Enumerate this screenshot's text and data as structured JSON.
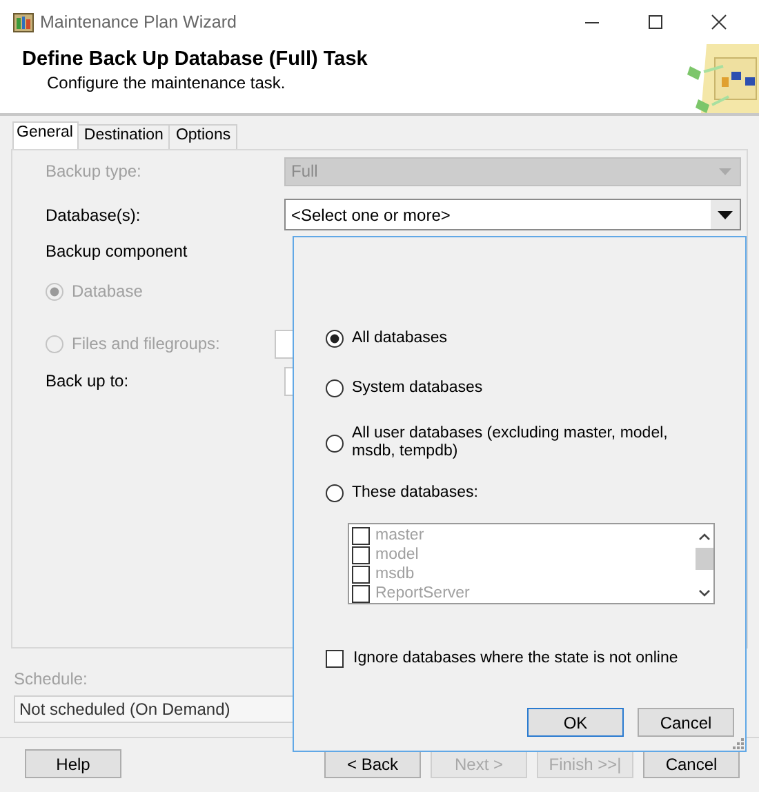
{
  "window": {
    "title": "Maintenance Plan Wizard"
  },
  "header": {
    "title": "Define Back Up Database (Full) Task",
    "subtitle": "Configure the maintenance task."
  },
  "tabs": [
    {
      "label": "General",
      "selected": true
    },
    {
      "label": "Destination",
      "selected": false
    },
    {
      "label": "Options",
      "selected": false
    }
  ],
  "form": {
    "backup_type": {
      "label": "Backup type:",
      "value": "Full",
      "disabled": true
    },
    "databases": {
      "label": "Database(s):",
      "value": "<Select one or more>"
    },
    "backup_component": {
      "label": "Backup component",
      "options": [
        {
          "label": "Database",
          "selected": true,
          "disabled": true
        },
        {
          "label": "Files and filegroups:",
          "selected": false,
          "disabled": true
        }
      ]
    },
    "back_up_to": {
      "label": "Back up to:"
    }
  },
  "schedule": {
    "label": "Schedule:",
    "value": "Not scheduled (On Demand)"
  },
  "buttons": [
    {
      "label": "Help",
      "disabled": false
    },
    {
      "label": "< Back",
      "disabled": false
    },
    {
      "label": "Next >",
      "disabled": true
    },
    {
      "label": "Finish >>|",
      "disabled": true
    },
    {
      "label": "Cancel",
      "disabled": false
    }
  ],
  "popup": {
    "options": [
      {
        "label": "All databases",
        "selected": true
      },
      {
        "label": "System databases",
        "selected": false
      },
      {
        "label": "All user databases  (excluding master, model, msdb, tempdb)",
        "selected": false
      },
      {
        "label": "These databases:",
        "selected": false
      }
    ],
    "database_list": {
      "disabled": true,
      "items": [
        {
          "label": "master",
          "checked": false
        },
        {
          "label": "model",
          "checked": false
        },
        {
          "label": "msdb",
          "checked": false
        },
        {
          "label": "ReportServer",
          "checked": false
        }
      ]
    },
    "ignore_offline": {
      "label": "Ignore databases where the state is not online",
      "checked": false
    },
    "buttons": [
      {
        "label": "OK",
        "default": true
      },
      {
        "label": "Cancel",
        "default": false
      }
    ]
  }
}
